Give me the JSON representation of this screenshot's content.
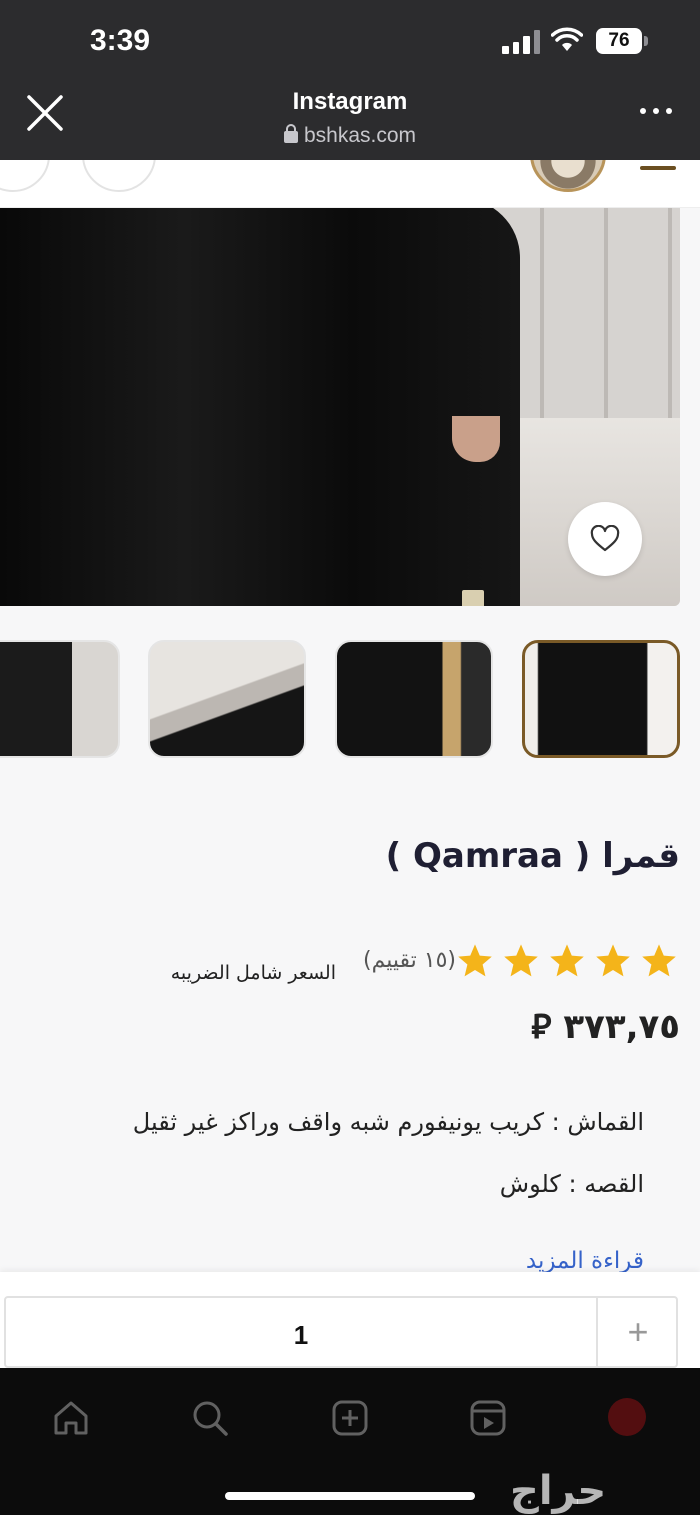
{
  "status_bar": {
    "time": "3:39",
    "battery": "76"
  },
  "browser": {
    "title": "Instagram",
    "url": "bshkas.com"
  },
  "product": {
    "title": "قمرا ( Qamraa )",
    "rating_stars": 5,
    "rating_count": "(١٥ تقييم)",
    "tax_note": "السعر شامل الضريبه",
    "price": "٣٧٣,٧٥ ⃁",
    "description": [
      "القماش : كريب يونيفورم شبه واقف وراكز غير ثقيل",
      "القصه : كلوش"
    ],
    "read_more": "قراءة المزيد"
  },
  "quantity": {
    "value": "1",
    "plus_label": "+"
  },
  "watermark": "حراج",
  "colors": {
    "accent_gold": "#7a5a27",
    "star": "#f4b41a",
    "link": "#3562c9"
  }
}
